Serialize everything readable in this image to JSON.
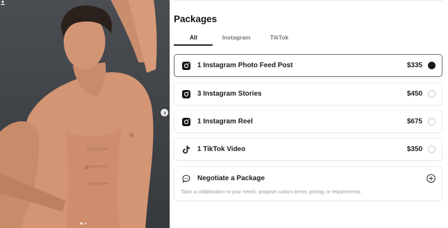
{
  "photo": {
    "next_icon": "chevron-right-icon",
    "dots": [
      true,
      false
    ]
  },
  "packages": {
    "title": "Packages",
    "tabs": [
      {
        "label": "All",
        "active": true
      },
      {
        "label": "Instagram",
        "active": false
      },
      {
        "label": "TikTok",
        "active": false
      }
    ],
    "items": [
      {
        "icon": "instagram-icon",
        "label": "1 Instagram Photo Feed Post",
        "price": "$335",
        "selected": true
      },
      {
        "icon": "instagram-icon",
        "label": "3 Instagram Stories",
        "price": "$450",
        "selected": false
      },
      {
        "icon": "instagram-icon",
        "label": "1 Instagram Reel",
        "price": "$675",
        "selected": false
      },
      {
        "icon": "tiktok-icon",
        "label": "1 TikTok Video",
        "price": "$350",
        "selected": false
      }
    ],
    "negotiate": {
      "icon": "chat-bubble-icon",
      "label": "Negotiate a Package",
      "description": "Tailor a collaboration to your needs: propose custom terms, pricing, or requirements.",
      "action_icon": "plus-circle-icon"
    }
  },
  "colors": {
    "selected_border": "#6f6f6f",
    "radio_on": "#1b1b1b",
    "photo_bg": "#43464b"
  }
}
